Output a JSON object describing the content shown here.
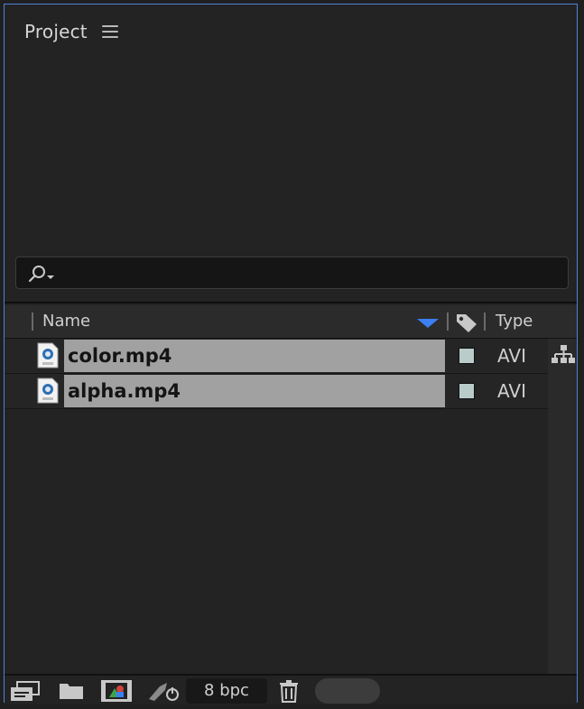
{
  "panel": {
    "title": "Project"
  },
  "search": {
    "placeholder": ""
  },
  "columns": {
    "name": "Name",
    "type": "Type"
  },
  "items": [
    {
      "name": "color.mp4",
      "type": "AVI",
      "label_color": "#b9ccca"
    },
    {
      "name": "alpha.mp4",
      "type": "AVI",
      "label_color": "#b9ccca"
    }
  ],
  "footer": {
    "bpc": "8 bpc"
  },
  "colors": {
    "accent_border": "#4e82d6",
    "sort_arrow": "#3b7ff0"
  }
}
